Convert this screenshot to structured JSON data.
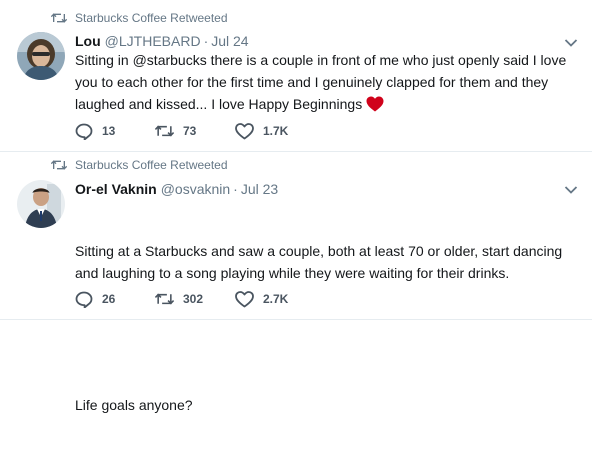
{
  "tweets": [
    {
      "retweet_context": "Starbucks Coffee Retweeted",
      "name": "Lou",
      "handle": "@LJTHEBARD",
      "separator": "·",
      "time": "Jul 24",
      "text": "Sitting in @starbucks there is a couple in front of me who just openly said I love you to each other for the first time and I genuinely clapped for them and they laughed and kissed... I love Happy Beginnings",
      "emoji": "red-heart",
      "replies": "13",
      "retweets": "73",
      "likes": "1.7K"
    },
    {
      "retweet_context": "Starbucks Coffee Retweeted",
      "name": "Or-el Vaknin",
      "handle": "@osvaknin",
      "separator": "·",
      "time": "Jul 23",
      "text_line1": "Sitting at a Starbucks and saw a couple, both at least 70 or older, start dancing and laughing to a song playing while they were waiting for their drinks.",
      "text_line2": "Life goals anyone?",
      "replies": "26",
      "retweets": "302",
      "likes": "2.7K"
    }
  ],
  "colors": {
    "text": "#14171a",
    "secondary": "#657786",
    "action": "#4a5560",
    "heart": "#d0021b",
    "divider": "#e6ecf0"
  },
  "icons": [
    "retweet-icon",
    "chevron-down-icon",
    "reply-icon",
    "retweet-icon",
    "like-icon",
    "red-heart-emoji"
  ]
}
